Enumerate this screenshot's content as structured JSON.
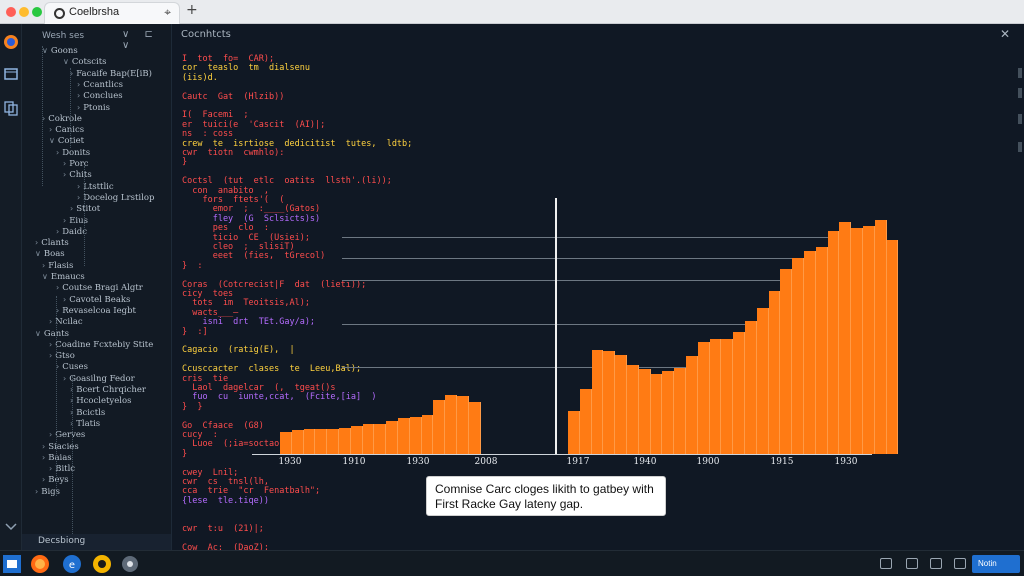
{
  "browser": {
    "tab_title": "Coelbrsha",
    "tab_close": "⌖",
    "new_tab": "+"
  },
  "sidebar": {
    "header_title": "Wesh ses",
    "header_actions": "∨ ⊏ ∨",
    "footer_label": "Decsbiong",
    "items": [
      {
        "label": "Goons",
        "indent": 2,
        "open": true
      },
      {
        "label": "Cotscits",
        "indent": 5,
        "open": true
      },
      {
        "label": "Facaife Bap(E[iB)",
        "indent": 6,
        "open": false
      },
      {
        "label": "Ccantlics",
        "indent": 7,
        "open": false
      },
      {
        "label": "Conclues",
        "indent": 7,
        "open": false
      },
      {
        "label": "Ptonis",
        "indent": 7,
        "open": false
      },
      {
        "label": "Cokrole",
        "indent": 2,
        "open": false
      },
      {
        "label": "Canics",
        "indent": 3,
        "open": false
      },
      {
        "label": "Cotiet",
        "indent": 3,
        "open": true
      },
      {
        "label": "Donits",
        "indent": 4,
        "open": false
      },
      {
        "label": "Porc",
        "indent": 5,
        "open": false
      },
      {
        "label": "Chits",
        "indent": 5,
        "open": false
      },
      {
        "label": "Ltsttlic",
        "indent": 7,
        "open": false
      },
      {
        "label": "Docelog Lrstilop",
        "indent": 7,
        "open": false
      },
      {
        "label": "Stitot",
        "indent": 6,
        "open": false
      },
      {
        "label": "Eius",
        "indent": 5,
        "open": false
      },
      {
        "label": "Daidc",
        "indent": 4,
        "open": false
      },
      {
        "label": "Clants",
        "indent": 1,
        "open": false
      },
      {
        "label": "Boas",
        "indent": 1,
        "open": true
      },
      {
        "label": "Flasis",
        "indent": 2,
        "open": false
      },
      {
        "label": "Emaucs",
        "indent": 2,
        "open": true
      },
      {
        "label": "Coutse Bragi Algtr",
        "indent": 4,
        "open": false
      },
      {
        "label": "Cavotel Beaks",
        "indent": 5,
        "open": false
      },
      {
        "label": "Revaselcoa Iegbt",
        "indent": 4,
        "open": false
      },
      {
        "label": "Ncilac",
        "indent": 3,
        "open": false
      },
      {
        "label": "Gants",
        "indent": 1,
        "open": true
      },
      {
        "label": "Coadine Fcxtebiy Stite",
        "indent": 3,
        "open": false
      },
      {
        "label": "Gtso",
        "indent": 3,
        "open": false
      },
      {
        "label": "Cuses",
        "indent": 4,
        "open": false
      },
      {
        "label": "Goasilng Fedor",
        "indent": 5,
        "open": false
      },
      {
        "label": "Bcert Chrqicher",
        "indent": 6,
        "open": false
      },
      {
        "label": "Hcocletyelos",
        "indent": 6,
        "open": false
      },
      {
        "label": "Bcictls",
        "indent": 6,
        "open": false
      },
      {
        "label": "Tlatis",
        "indent": 6,
        "open": false
      },
      {
        "label": "Gerves",
        "indent": 3,
        "open": false
      },
      {
        "label": "Siacies",
        "indent": 2,
        "open": false
      },
      {
        "label": "Baias",
        "indent": 2,
        "open": false
      },
      {
        "label": "Bitlc",
        "indent": 3,
        "open": false
      },
      {
        "label": "Beys",
        "indent": 2,
        "open": false
      },
      {
        "label": "Bigs",
        "indent": 1,
        "open": false
      }
    ]
  },
  "editor": {
    "title": "Cocnhtcts",
    "close": "✕",
    "code_lines": [
      {
        "text": "I  tot  fo=  CAR);",
        "color": "#ff4d4d"
      },
      {
        "text": "cor  teaslo  tm  dialsenu",
        "color": "#ffd23f"
      },
      {
        "text": "(iis)d.",
        "color": "#ffd23f"
      },
      {
        "text": "",
        "color": "#ffffff"
      },
      {
        "text": "Cautc  Gat  (Hlzib))",
        "color": "#ff4d4d"
      },
      {
        "text": "",
        "color": "#ffffff"
      },
      {
        "text": "I(  Facemi  ;",
        "color": "#ff4d4d"
      },
      {
        "text": "er  tuici(e  'Cascit  (AI)|;",
        "color": "#ff4d4d"
      },
      {
        "text": "ns  : coss",
        "color": "#ff4d4d"
      },
      {
        "text": "crew  te  isrtiose  dedicitist  tutes,  ldtb;",
        "color": "#ffd23f"
      },
      {
        "text": "cwr  tiotn  cwmhlo):",
        "color": "#ff4d4d"
      },
      {
        "text": "}",
        "color": "#ff4d4d"
      },
      {
        "text": "",
        "color": "#ffffff"
      },
      {
        "text": "Coctsl  (tut  etlc  oatits  llsth'.(li));",
        "color": "#ff4d4d"
      },
      {
        "text": "  con  anabito  ,",
        "color": "#ff4d4d"
      },
      {
        "text": "    fors  ftets'(  (",
        "color": "#ff4d4d"
      },
      {
        "text": "      emor  ;  :____(Gatos)",
        "color": "#ff4d4d"
      },
      {
        "text": "      fley  (G  Sclsicts)s)",
        "color": "#b56cff"
      },
      {
        "text": "      pes  clo  :",
        "color": "#ff4d4d"
      },
      {
        "text": "      ticio  CE  (Usiei);",
        "color": "#ff4d4d"
      },
      {
        "text": "      cleo  ;  slisiT)",
        "color": "#ff4d4d"
      },
      {
        "text": "      eeet  (fies,  tGrecol)",
        "color": "#ff4d4d"
      },
      {
        "text": "}  :",
        "color": "#ff4d4d"
      },
      {
        "text": "",
        "color": "#ffffff"
      },
      {
        "text": "Coras  (Cotcrecist|F  dat  (lieti));",
        "color": "#ff4d4d"
      },
      {
        "text": "cicy  toes",
        "color": "#ff4d4d"
      },
      {
        "text": "  tots  im  Teoitsis,Al);",
        "color": "#ff4d4d"
      },
      {
        "text": "  wacts___—",
        "color": "#ff4d4d"
      },
      {
        "text": "    isni  drt  TEt.Gay/a);",
        "color": "#b56cff"
      },
      {
        "text": "}  :]",
        "color": "#ff4d4d"
      },
      {
        "text": "",
        "color": "#ffffff"
      },
      {
        "text": "Cagacio  (ratig(E),  |",
        "color": "#ffd23f"
      },
      {
        "text": "",
        "color": "#ffffff"
      },
      {
        "text": "Ccusccacter  clases  te  Leeu,Bal);",
        "color": "#ffd23f"
      },
      {
        "text": "cris  tie",
        "color": "#ff4d4d"
      },
      {
        "text": "  Laol  dagelcar  (,  tgeat()s",
        "color": "#ff4d4d"
      },
      {
        "text": "  fuo  cu  iunte,ccat,  (Fcite,[ia]  )",
        "color": "#b56cff"
      },
      {
        "text": "}  }",
        "color": "#ff4d4d"
      },
      {
        "text": "",
        "color": "#ffffff"
      },
      {
        "text": "Go  Cfaace  (G8)",
        "color": "#ff4d4d"
      },
      {
        "text": "cucy  :",
        "color": "#ff4d4d"
      },
      {
        "text": "  Luoe  (;ia=soctaon",
        "color": "#ff4d4d"
      },
      {
        "text": "}",
        "color": "#ff4d4d"
      },
      {
        "text": "",
        "color": "#ffffff"
      },
      {
        "text": "cwey  Lnil;",
        "color": "#ff4d4d"
      },
      {
        "text": "cwr  cs  tnsl(lh,",
        "color": "#ff4d4d"
      },
      {
        "text": "cca  trie  \"cr  Fenatbalh\";",
        "color": "#ff4d4d"
      },
      {
        "text": "{lese  tle.tiqe))",
        "color": "#b56cff"
      },
      {
        "text": "",
        "color": "#ffffff"
      },
      {
        "text": "",
        "color": "#ffffff"
      },
      {
        "text": "cwr  t:u  (21)|;",
        "color": "#ff4d4d"
      },
      {
        "text": "",
        "color": "#ffffff"
      },
      {
        "text": "Cow  Ac:  (DaoZ);",
        "color": "#ff4d4d"
      }
    ]
  },
  "chart_data": {
    "type": "bar",
    "title": "",
    "xlabel": "",
    "ylabel": "",
    "x_tick_labels_left": [
      "1930",
      "1910",
      "1930",
      "2008"
    ],
    "x_tick_labels_right": [
      "1917",
      "1940",
      "1900",
      "1915",
      "1930"
    ],
    "series": [
      {
        "values_left": [
          20,
          22,
          23,
          23,
          23,
          24,
          26,
          28,
          28,
          30,
          33,
          34,
          36,
          50,
          54,
          53,
          48
        ],
        "values_right": [
          40,
          60,
          96,
          95,
          91,
          82,
          78,
          74,
          76,
          79,
          90,
          103,
          106,
          106,
          112,
          122,
          134,
          150,
          170,
          180,
          187,
          190,
          205,
          213,
          208,
          210,
          215,
          197
        ]
      }
    ],
    "ylim": [
      0,
      230
    ],
    "grid": true,
    "caption": "Comnise Carc cloges likith to gatbey with First Racke Gay lateny gap."
  },
  "taskbar": {
    "tray_button": "Notin"
  },
  "colors": {
    "bar": "#ff7b14",
    "background": "#101824",
    "sidebar": "#121a24"
  }
}
